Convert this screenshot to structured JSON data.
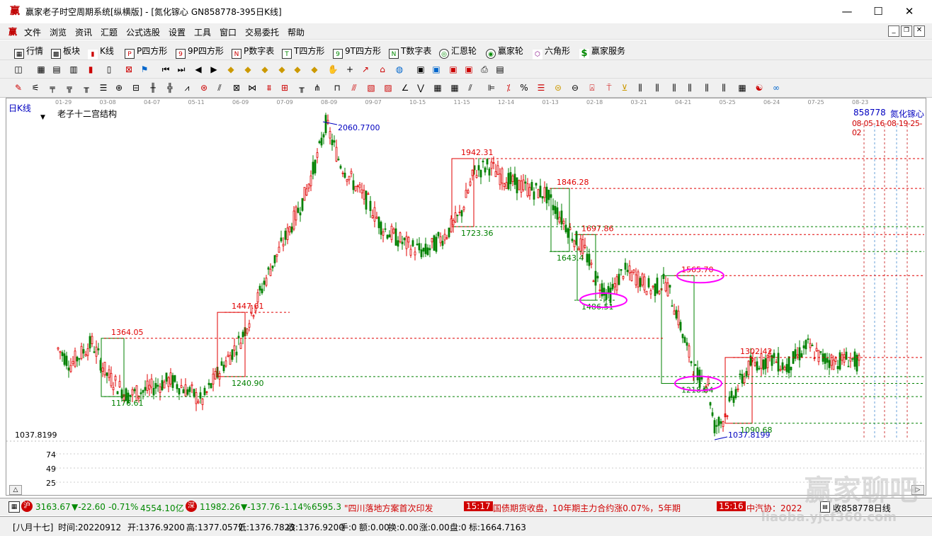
{
  "window": {
    "title": "赢家老子时空周期系统[纵横版] - [氮化镓心   GN858778-395日K线]",
    "controls": [
      "—",
      "☐",
      "✕"
    ]
  },
  "menu": [
    "文件",
    "浏览",
    "资讯",
    "汇题",
    "公式选股",
    "设置",
    "工具",
    "窗口",
    "交易委托",
    "帮助"
  ],
  "toolbar1": [
    "行情",
    "板块",
    "K线",
    "P四方形",
    "9P四方形",
    "P数字表",
    "T四方形",
    "9T四方形",
    "T数字表",
    "汇恩轮",
    "赢家轮",
    "六角形",
    "赢家服务"
  ],
  "toolbar1_icons": [
    "grid-icon",
    "blocks-icon",
    "kline-icon",
    "ps-icon",
    "9p-icon",
    "pn-icon",
    "ts-icon",
    "9t-icon",
    "tn-icon",
    "wheel-icon",
    "wheel2-icon",
    "hexagon-icon",
    "dollar-icon"
  ],
  "chart": {
    "period_label": "日K线",
    "indicator_name": "老子十二宫结构",
    "stock_code": "858778",
    "stock_name": "氮化镓心",
    "future_dates": "08-05-16-08-19-25-02",
    "date_ticks": [
      "01-29",
      "03-08",
      "04-07",
      "05-11",
      "06-09",
      "07-09",
      "08-09",
      "09-07",
      "10-15",
      "11-15",
      "12-14",
      "01-13",
      "02-18",
      "03-21",
      "04-21",
      "05-25",
      "06-24",
      "07-25",
      "08-23"
    ],
    "left_price_label": "1037.8199",
    "vol_ticks": [
      "74",
      "49",
      "25"
    ],
    "levels_red": [
      {
        "label": "1364.05",
        "price": 1364.05
      },
      {
        "label": "1447.61",
        "price": 1447.61
      },
      {
        "label": "1942.31",
        "price": 1942.31
      },
      {
        "label": "1846.28",
        "price": 1846.28
      },
      {
        "label": "1697.86",
        "price": 1697.86
      },
      {
        "label": "1565.70",
        "price": 1565.7
      },
      {
        "label": "1302.42",
        "price": 1302.42
      }
    ],
    "levels_green": [
      {
        "label": "1176.61",
        "price": 1176.61
      },
      {
        "label": "1240.90",
        "price": 1240.9
      },
      {
        "label": "1723.36",
        "price": 1723.36
      },
      {
        "label": "1643.4",
        "price": 1643.4
      },
      {
        "label": "1486.51",
        "price": 1486.51
      },
      {
        "label": "1218.84",
        "price": 1218.84
      },
      {
        "label": "1090.68",
        "price": 1090.68
      }
    ],
    "extremes": [
      {
        "label": "2060.7700",
        "price": 2060.77
      },
      {
        "label": "1037.8199",
        "price": 1037.8199
      }
    ],
    "colors": {
      "up": "#e00000",
      "down": "#008000",
      "box_red": "#e00000",
      "box_green": "#008000",
      "ellipse": "#ff00ff",
      "extreme": "#0000c0"
    }
  },
  "ticker": {
    "sh_val": "3163.67",
    "sh_chg": "▼-22.60",
    "sh_pct": "-0.71%",
    "sh_amt": "4554.10亿",
    "sz_val": "11982.26",
    "sz_chg": "▼-137.76",
    "sz_pct": "-1.14%",
    "sz_amt": "6595.3",
    "news1": "\"四川落地方案首次印发",
    "news2_time": "15:17",
    "news2": "国债期货收盘，10年期主力合约涨0.07%，5年期",
    "news3_time": "15:16",
    "news3": "中汽协：2022",
    "right_label": "收858778日线"
  },
  "status": {
    "lunar": "[八月十七]",
    "time": "时间:20220912",
    "open": "开:1376.9200",
    "high": "高:1377.0577",
    "low": "低:1376.7823",
    "close": "收:1376.9200",
    "hand": "手:0",
    "amount": "额:0.00",
    "turnover": "换:0.00",
    "change": "涨:0.00",
    "disk": "盘:0",
    "mark": "标:1664.7163"
  },
  "watermark": "赢家聊吧",
  "watermark_url": "liaoba.yjcf360.com"
}
